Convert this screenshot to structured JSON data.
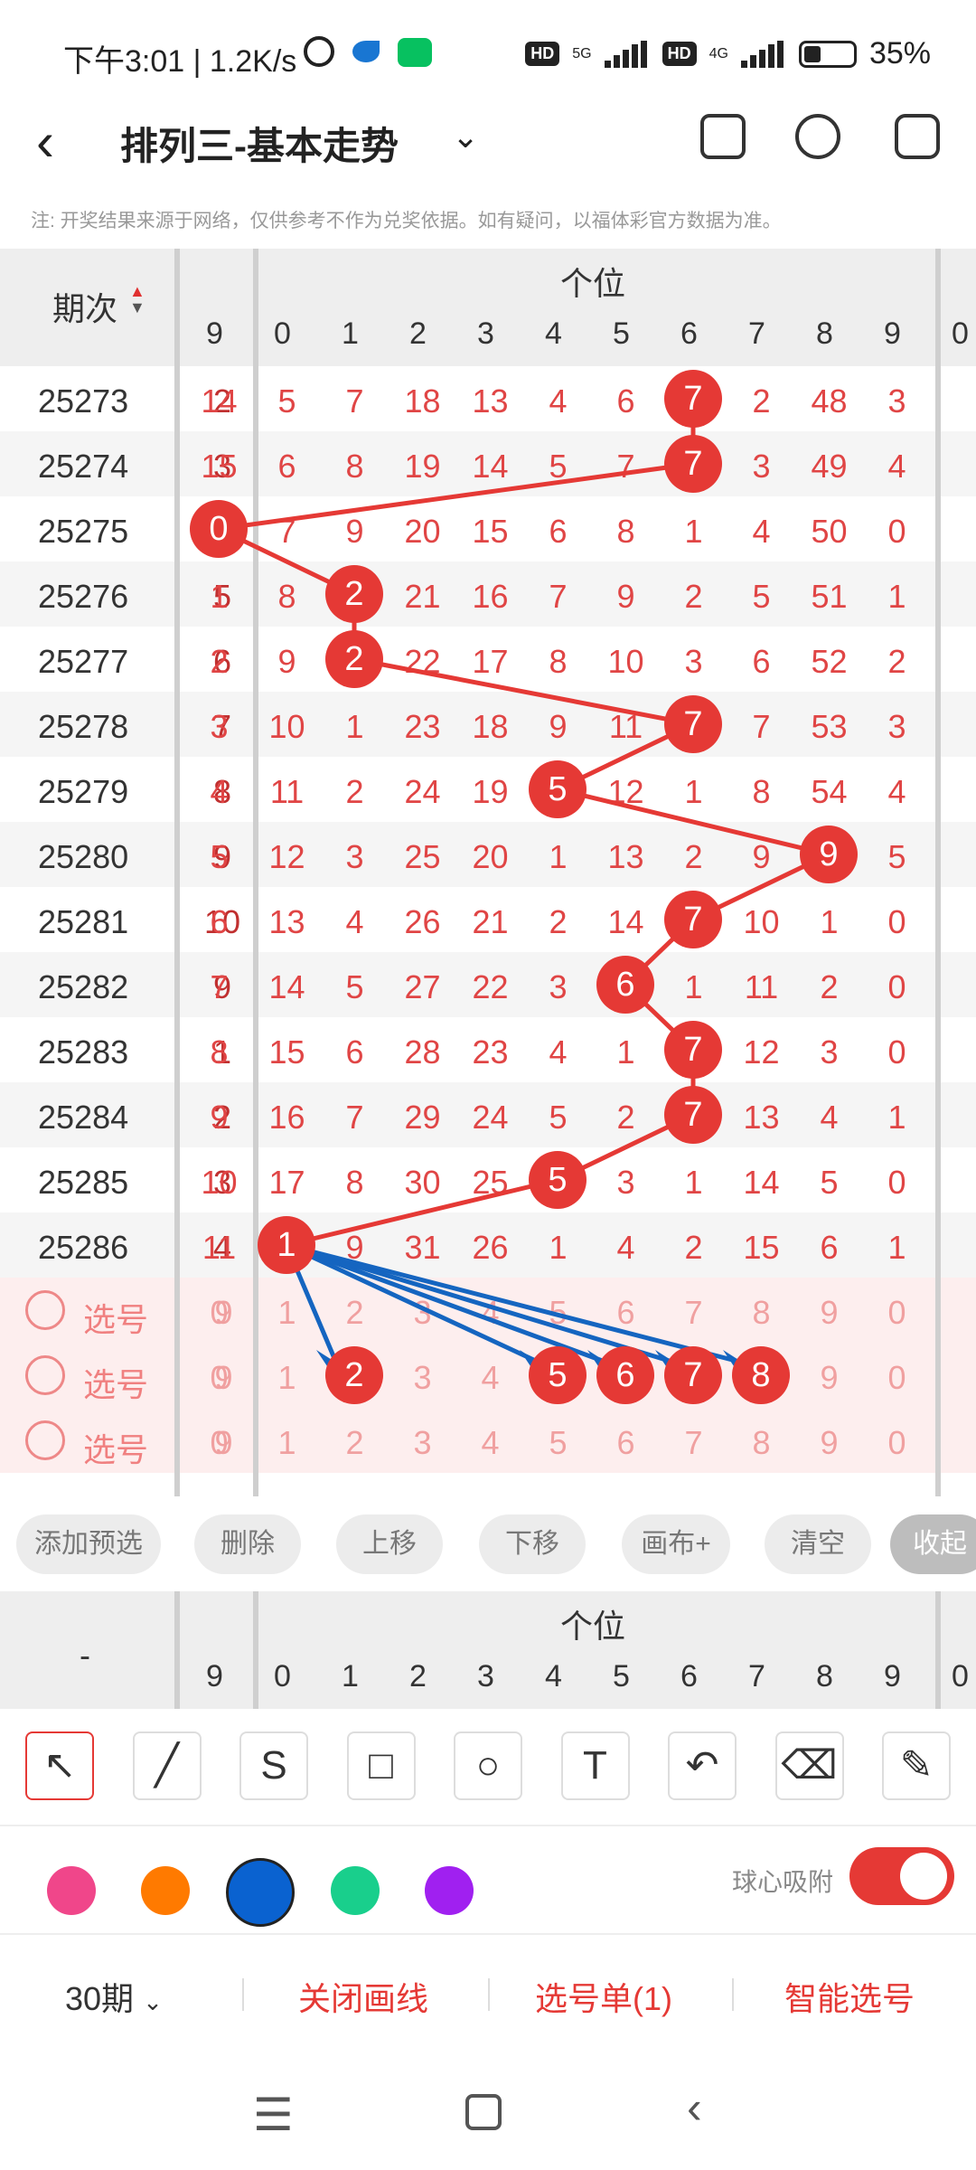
{
  "status_bar": {
    "time": "下午3:01 | 1.2K/s",
    "net1": "5G",
    "net2": "4G",
    "hd": "HD",
    "battery": "35%"
  },
  "topbar": {
    "title": "排列三-基本走势"
  },
  "note": "注: 开奖结果来源于网络，仅供参考不作为兑奖依据。如有疑问，以福体彩官方数据为准。",
  "grid_header": {
    "issue_label": "期次",
    "position_label": "个位",
    "digits": [
      "9",
      "0",
      "1",
      "2",
      "3",
      "4",
      "5",
      "6",
      "7",
      "8",
      "9",
      "0"
    ]
  },
  "rows": [
    {
      "issue": "25273",
      "omit": "2",
      "cells": [
        "14",
        "5",
        "7",
        "18",
        "13",
        "4",
        "6",
        "7",
        "2",
        "48",
        "3"
      ],
      "hit": 7
    },
    {
      "issue": "25274",
      "omit": "3",
      "cells": [
        "15",
        "6",
        "8",
        "19",
        "14",
        "5",
        "7",
        "7",
        "3",
        "49",
        "4"
      ],
      "hit": 7
    },
    {
      "issue": "25275",
      "omit": "4",
      "cells": [
        "0",
        "7",
        "9",
        "20",
        "15",
        "6",
        "8",
        "1",
        "4",
        "50",
        "0"
      ],
      "hit": 0
    },
    {
      "issue": "25276",
      "omit": "5",
      "cells": [
        "1",
        "8",
        "2",
        "21",
        "16",
        "7",
        "9",
        "2",
        "5",
        "51",
        "1"
      ],
      "hit": 2
    },
    {
      "issue": "25277",
      "omit": "6",
      "cells": [
        "2",
        "9",
        "2",
        "22",
        "17",
        "8",
        "10",
        "3",
        "6",
        "52",
        "2"
      ],
      "hit": 2
    },
    {
      "issue": "25278",
      "omit": "7",
      "cells": [
        "3",
        "10",
        "1",
        "23",
        "18",
        "9",
        "11",
        "7",
        "7",
        "53",
        "3"
      ],
      "hit": 7
    },
    {
      "issue": "25279",
      "omit": "8",
      "cells": [
        "4",
        "11",
        "2",
        "24",
        "19",
        "5",
        "12",
        "1",
        "8",
        "54",
        "4"
      ],
      "hit": 5
    },
    {
      "issue": "25280",
      "omit": "9",
      "cells": [
        "5",
        "12",
        "3",
        "25",
        "20",
        "1",
        "13",
        "2",
        "9",
        "9",
        "5"
      ],
      "hit": 9
    },
    {
      "issue": "25281",
      "omit": "10",
      "cells": [
        "6",
        "13",
        "4",
        "26",
        "21",
        "2",
        "14",
        "7",
        "10",
        "1",
        "0"
      ],
      "hit": 7
    },
    {
      "issue": "25282",
      "omit": "9",
      "cells": [
        "7",
        "14",
        "5",
        "27",
        "22",
        "3",
        "6",
        "1",
        "11",
        "2",
        "0"
      ],
      "hit": 6
    },
    {
      "issue": "25283",
      "omit": "1",
      "cells": [
        "8",
        "15",
        "6",
        "28",
        "23",
        "4",
        "1",
        "7",
        "12",
        "3",
        "0"
      ],
      "hit": 7
    },
    {
      "issue": "25284",
      "omit": "2",
      "cells": [
        "9",
        "16",
        "7",
        "29",
        "24",
        "5",
        "2",
        "7",
        "13",
        "4",
        "1"
      ],
      "hit": 7
    },
    {
      "issue": "25285",
      "omit": "3",
      "cells": [
        "10",
        "17",
        "8",
        "30",
        "25",
        "5",
        "3",
        "1",
        "14",
        "5",
        "0"
      ],
      "hit": 5
    },
    {
      "issue": "25286",
      "omit": "4",
      "cells": [
        "11",
        "1",
        "9",
        "31",
        "26",
        "1",
        "4",
        "2",
        "15",
        "6",
        "1"
      ],
      "hit": 1
    }
  ],
  "picks": [
    {
      "label": "选号",
      "digits": [
        "9",
        "0",
        "1",
        "2",
        "3",
        "4",
        "5",
        "6",
        "7",
        "8",
        "9",
        "0"
      ]
    },
    {
      "label": "选号",
      "digits": [
        "9",
        "0",
        "1",
        "2",
        "3",
        "4",
        "5",
        "6",
        "7",
        "8",
        "9",
        "0"
      ],
      "selected": [
        "2",
        "5",
        "6",
        "7",
        "8"
      ]
    },
    {
      "label": "选号",
      "digits": [
        "9",
        "0",
        "1",
        "2",
        "3",
        "4",
        "5",
        "6",
        "7",
        "8",
        "9",
        "0"
      ]
    }
  ],
  "actions": [
    "添加预选",
    "删除",
    "上移",
    "下移",
    "画布+",
    "清空",
    "收起"
  ],
  "grid_header2": {
    "dash": "-",
    "position_label": "个位"
  },
  "tools": [
    "pointer-arrow-icon",
    "line-icon",
    "curve-icon",
    "rectangle-icon",
    "circle-icon",
    "text-icon",
    "undo-icon",
    "eraser-icon",
    "brush-icon"
  ],
  "colors": [
    "#f0468a",
    "#ff7a00",
    "#0a62d0",
    "#19cf8c",
    "#a020f0"
  ],
  "snap_label": "球心吸附",
  "bottom": {
    "period": "30期",
    "close_draw": "关闭画线",
    "pick_list": "选号单(1)",
    "smart_pick": "智能选号"
  }
}
